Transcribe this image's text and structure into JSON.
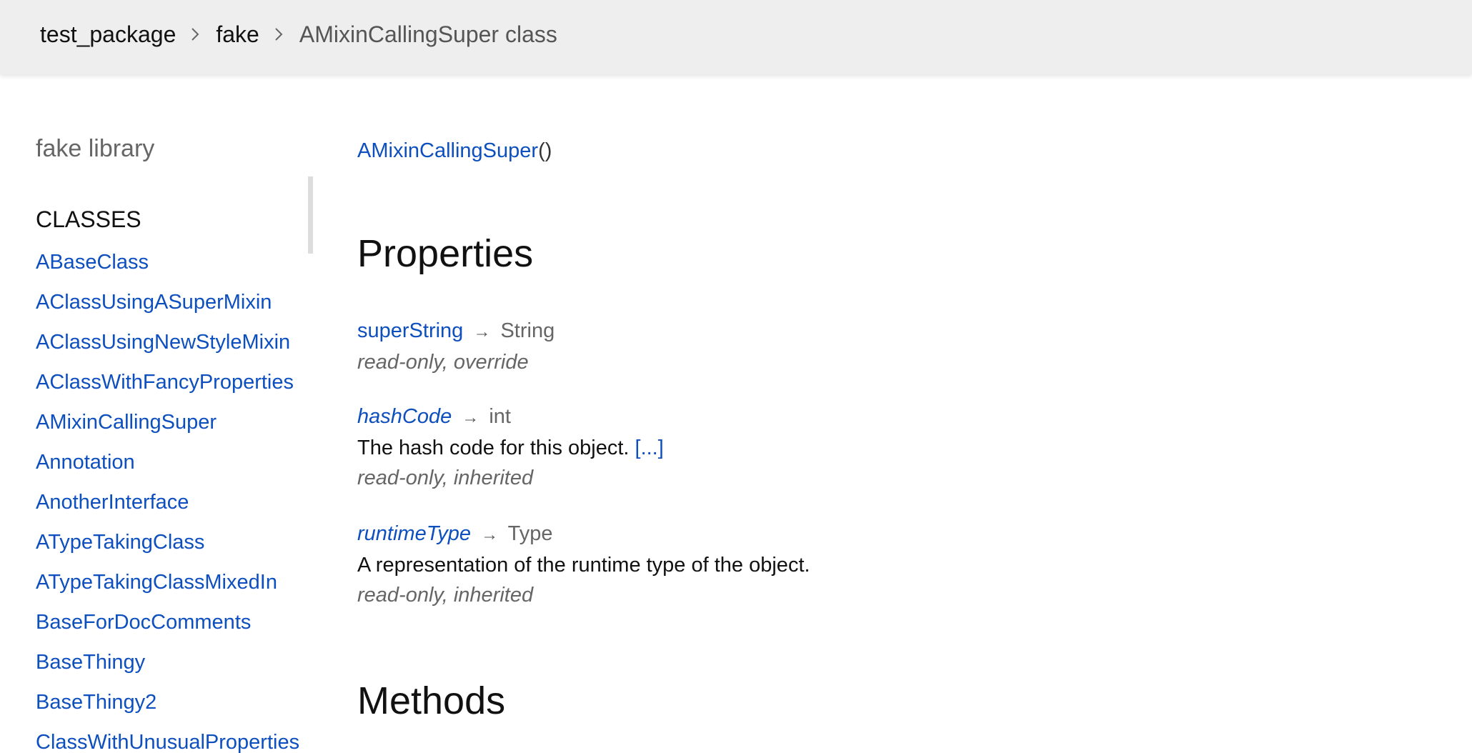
{
  "breadcrumbs": {
    "package": "test_package",
    "library": "fake",
    "current": "AMixinCallingSuper class"
  },
  "sidebar": {
    "header": "fake library",
    "section_title": "CLASSES",
    "classes": [
      "ABaseClass",
      "AClassUsingASuperMixin",
      "AClassUsingNewStyleMixin",
      "AClassWithFancyProperties",
      "AMixinCallingSuper",
      "Annotation",
      "AnotherInterface",
      "ATypeTakingClass",
      "ATypeTakingClassMixedIn",
      "BaseForDocComments",
      "BaseThingy",
      "BaseThingy2",
      "ClassWithUnusualProperties"
    ]
  },
  "main": {
    "constructor": {
      "name": "AMixinCallingSuper",
      "params": "()"
    },
    "properties_heading": "Properties",
    "properties": [
      {
        "name": "superString",
        "arrow": "→",
        "type": "String",
        "description": "",
        "more_link": "",
        "features": "read-only, override"
      },
      {
        "name": "hashCode",
        "arrow": "→",
        "type": "int",
        "description": "The hash code for this object.",
        "more_link": "[...]",
        "features": "read-only, inherited"
      },
      {
        "name": "runtimeType",
        "arrow": "→",
        "type": "Type",
        "description": "A representation of the runtime type of the object.",
        "more_link": "",
        "features": "read-only, inherited"
      }
    ],
    "methods_heading": "Methods"
  },
  "colors": {
    "link": "#0d4fbf",
    "topbar_bg": "#eeeeee",
    "muted_text": "#666666"
  },
  "icons": {
    "breadcrumb_separator": "chevron-right-icon"
  }
}
